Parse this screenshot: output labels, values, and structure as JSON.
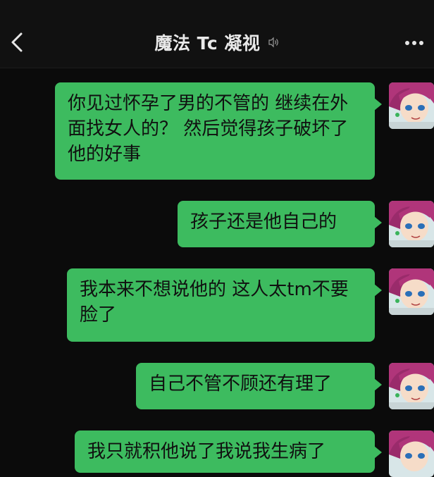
{
  "header": {
    "title": "魔法 Tc 凝视",
    "back_icon": "chevron-left-icon",
    "mute_icon": "muted-speaker-icon",
    "more_icon": "more-horizontal-icon"
  },
  "messages": [
    {
      "text": "你见过怀孕了男的不管的 继续在外面找女人的？ 然后觉得孩子破坏了他的好事"
    },
    {
      "text": "孩子还是他自己的"
    },
    {
      "text": "我本来不想说他的 这人太tm不要脸了"
    },
    {
      "text": "自己不管不顾还有理了"
    },
    {
      "text": "我只就积他说了我说我生病了"
    }
  ],
  "colors": {
    "bubble": "#3dbb5f",
    "background": "#0b0b0b",
    "header": "#111111"
  }
}
